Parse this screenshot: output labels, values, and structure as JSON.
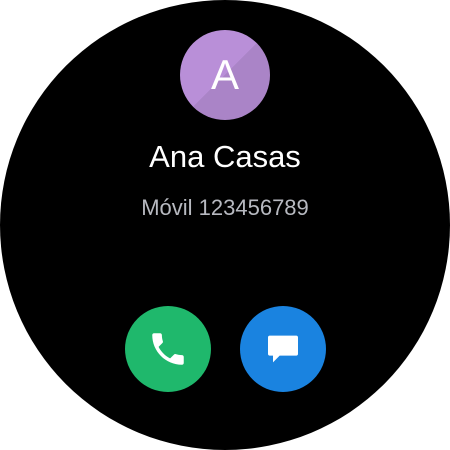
{
  "contact": {
    "initial": "A",
    "name": "Ana Casas",
    "number_line": "Móvil 123456789"
  },
  "actions": {
    "call": {
      "icon": "phone-icon"
    },
    "message": {
      "icon": "message-icon"
    }
  },
  "colors": {
    "background": "#000000",
    "avatar": "#b98fd8",
    "name_text": "#ffffff",
    "number_text": "#b7b9c0",
    "call_button": "#1fb86c",
    "message_button": "#1a83e0",
    "icon": "#ffffff"
  }
}
